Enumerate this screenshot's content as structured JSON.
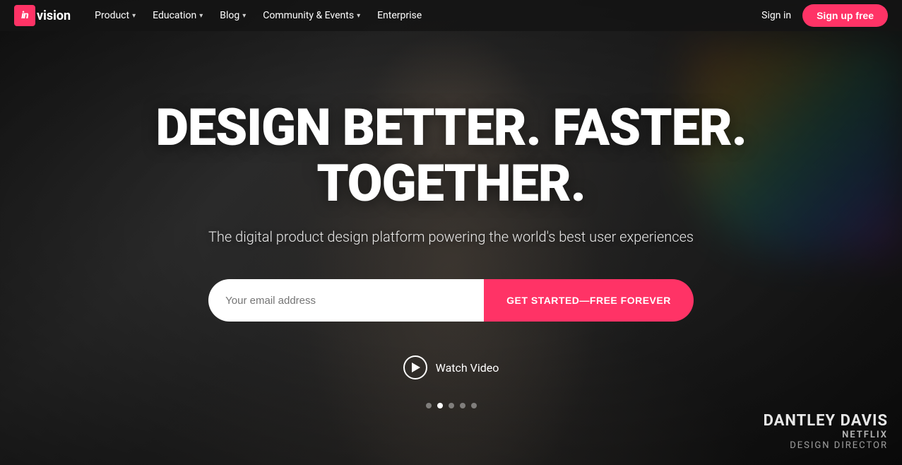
{
  "nav": {
    "logo": {
      "in_text": "in",
      "vision_text": "vision"
    },
    "items": [
      {
        "label": "Product",
        "has_dropdown": true
      },
      {
        "label": "Education",
        "has_dropdown": true
      },
      {
        "label": "Blog",
        "has_dropdown": true
      },
      {
        "label": "Community & Events",
        "has_dropdown": true
      },
      {
        "label": "Enterprise",
        "has_dropdown": false
      }
    ],
    "sign_in": "Sign in",
    "signup": "Sign up free"
  },
  "hero": {
    "title": "DESIGN BETTER. FASTER. TOGETHER.",
    "subtitle": "The digital product design platform powering the world's best user experiences",
    "email_placeholder": "Your email address",
    "cta_button": "GET STARTED—FREE FOREVER",
    "watch_video": "Watch Video"
  },
  "credit": {
    "name": "DANTLEY DAVIS",
    "company": "NETFLIX",
    "role": "DESIGN DIRECTOR"
  }
}
